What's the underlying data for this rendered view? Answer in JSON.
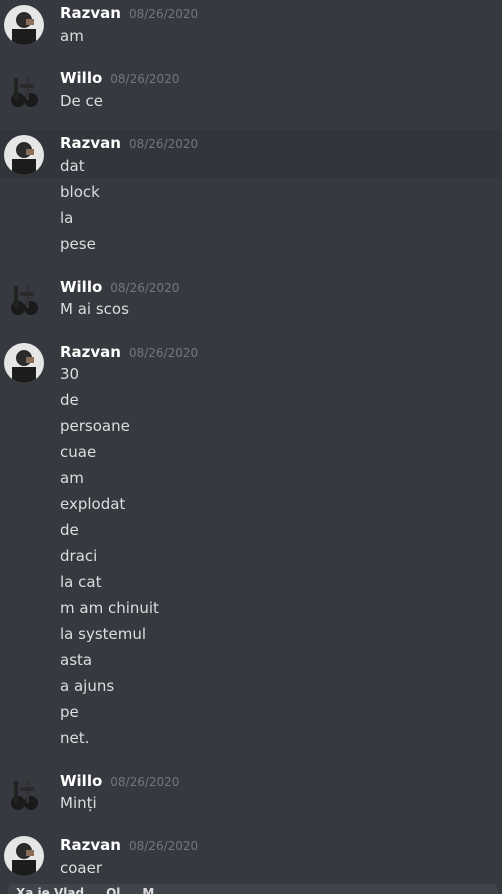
{
  "messages": [
    {
      "user": "Razvan",
      "time": "08/26/2020",
      "avatar": "razvan-avatar",
      "lines": [
        "am"
      ]
    },
    {
      "user": "Willo",
      "time": "08/26/2020",
      "avatar": "willo-avatar",
      "lines": [
        "De ce"
      ]
    },
    {
      "user": "Razvan",
      "time": "08/26/2020",
      "avatar": "razvan-avatar",
      "lines": [
        "dat",
        "block",
        "la",
        "pese"
      ]
    },
    {
      "user": "Willo",
      "time": "08/26/2020",
      "avatar": "willo-avatar",
      "lines": [
        "M ai scos"
      ]
    },
    {
      "user": "Razvan",
      "time": "08/26/2020",
      "avatar": "razvan-avatar",
      "lines": [
        "30",
        "de",
        "persoane",
        "cuae",
        "am",
        "explodat",
        "de",
        "draci",
        "la cat",
        "m am chinuit",
        "la systemul",
        "asta",
        "a ajuns",
        "pe",
        "net."
      ]
    },
    {
      "user": "Willo",
      "time": "08/26/2020",
      "avatar": "willo-avatar",
      "lines": [
        "Minți"
      ]
    },
    {
      "user": "Razvan",
      "time": "08/26/2020",
      "avatar": "razvan-avatar",
      "lines": [
        "coaer"
      ]
    }
  ],
  "composer": {
    "text": "Xa ie Vlad ... Ol ... M"
  },
  "colors": {
    "background": "#36393f",
    "username": "#ffffff",
    "text": "#dcddde",
    "timestamp": "#72767d"
  }
}
